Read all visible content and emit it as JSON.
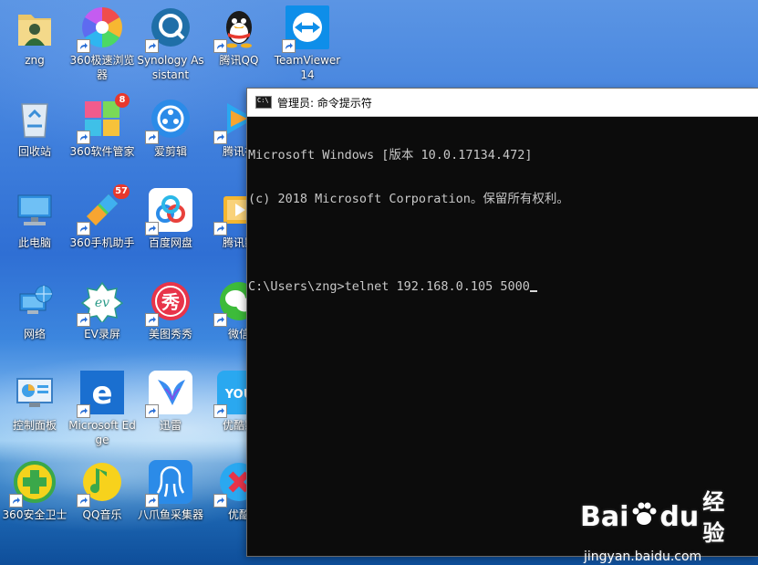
{
  "desktop": {
    "icons": [
      {
        "label": "zng",
        "icon": "user-folder-icon"
      },
      {
        "label": "360极速浏览器",
        "icon": "360-speed-browser-icon"
      },
      {
        "label": "Synology Assistant",
        "icon": "synology-assistant-icon"
      },
      {
        "label": "腾讯QQ",
        "icon": "qq-penguin-icon"
      },
      {
        "label": "TeamViewer 14",
        "icon": "teamviewer-icon"
      },
      {
        "label": "回收站",
        "icon": "recycle-bin-icon"
      },
      {
        "label": "360软件管家",
        "icon": "360-software-manager-icon",
        "badge": "8"
      },
      {
        "label": "爱剪辑",
        "icon": "aijianji-icon"
      },
      {
        "label": "腾讯视",
        "icon": "tencent-video-icon"
      },
      {
        "label": "此电脑",
        "icon": "this-pc-icon"
      },
      {
        "label": "360手机助手",
        "icon": "360-mobile-assistant-icon",
        "badge": "57"
      },
      {
        "label": "百度网盘",
        "icon": "baidu-netdisk-icon"
      },
      {
        "label": "腾讯影",
        "icon": "tencent-film-icon"
      },
      {
        "label": "网络",
        "icon": "network-icon"
      },
      {
        "label": "EV录屏",
        "icon": "ev-recorder-icon"
      },
      {
        "label": "美图秀秀",
        "icon": "meitu-xiuxiu-icon"
      },
      {
        "label": "微信",
        "icon": "wechat-icon"
      },
      {
        "label": "控制面板",
        "icon": "control-panel-icon"
      },
      {
        "label": "Microsoft Edge",
        "icon": "edge-icon"
      },
      {
        "label": "迅雷",
        "icon": "xunlei-icon"
      },
      {
        "label": "优酷影",
        "icon": "youku-icon"
      },
      {
        "label": "360安全卫士",
        "icon": "360-security-icon"
      },
      {
        "label": "QQ音乐",
        "icon": "qq-music-icon"
      },
      {
        "label": "八爪鱼采集器",
        "icon": "octopus-collector-icon"
      },
      {
        "label": "优酷",
        "icon": "youku-red-icon"
      }
    ]
  },
  "cmd": {
    "title": "管理员: 命令提示符",
    "lines": [
      "Microsoft Windows [版本 10.0.17134.472]",
      "(c) 2018 Microsoft Corporation。保留所有权利。",
      "",
      "C:\\Users\\zng>telnet 192.168.0.105 5000"
    ]
  },
  "watermark": {
    "logo_left": "Bai",
    "logo_right": "du",
    "logo_cn": "经验",
    "url": "jingyan.baidu.com"
  },
  "colors": {
    "console_bg": "#0c0c0c",
    "console_text": "#c8c8c8",
    "titlebar_bg": "#ffffff"
  }
}
